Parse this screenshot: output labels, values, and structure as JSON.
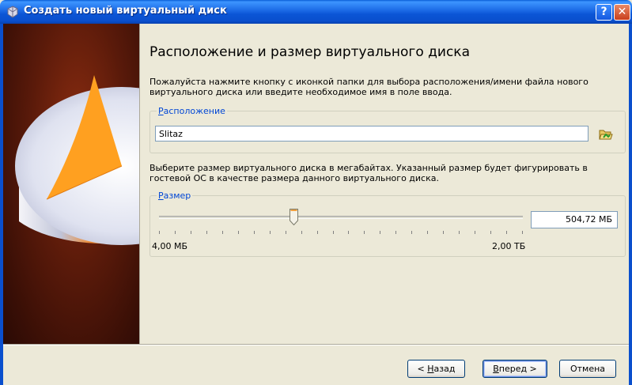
{
  "window": {
    "title": "Создать новый виртуальный диск",
    "help_label": "?",
    "close_label": "✕"
  },
  "page": {
    "heading": "Расположение и размер виртуального диска",
    "intro": "Пожалуйста нажмите кнопку с иконкой папки для выбора расположения/имени файла нового виртуального диска или введите необходимое имя в поле ввода."
  },
  "location": {
    "group_label_accel": "Р",
    "group_label_rest": "асположение",
    "value": "Slitaz",
    "folder_icon": "folder-open-icon"
  },
  "size": {
    "description": "Выберите размер виртуального диска в мегабайтах. Указанный размер будет фигурировать в гостевой ОС в качестве размера данного виртуального диска.",
    "group_label_accel": "Р",
    "group_label_rest": "азмер",
    "value": "504,72 МБ",
    "min_label": "4,00 МБ",
    "max_label": "2,00 ТБ",
    "slider_fraction": 0.37
  },
  "buttons": {
    "back_prefix": "< ",
    "back_accel": "Н",
    "back_rest": "азад",
    "next_accel": "В",
    "next_rest": "перед >",
    "cancel": "Отмена"
  },
  "colors": {
    "titlebar": "#0a4fcd",
    "group_label": "#0046d5",
    "side_background": "#5a1a0a",
    "disk_slice": "#ffa020"
  }
}
